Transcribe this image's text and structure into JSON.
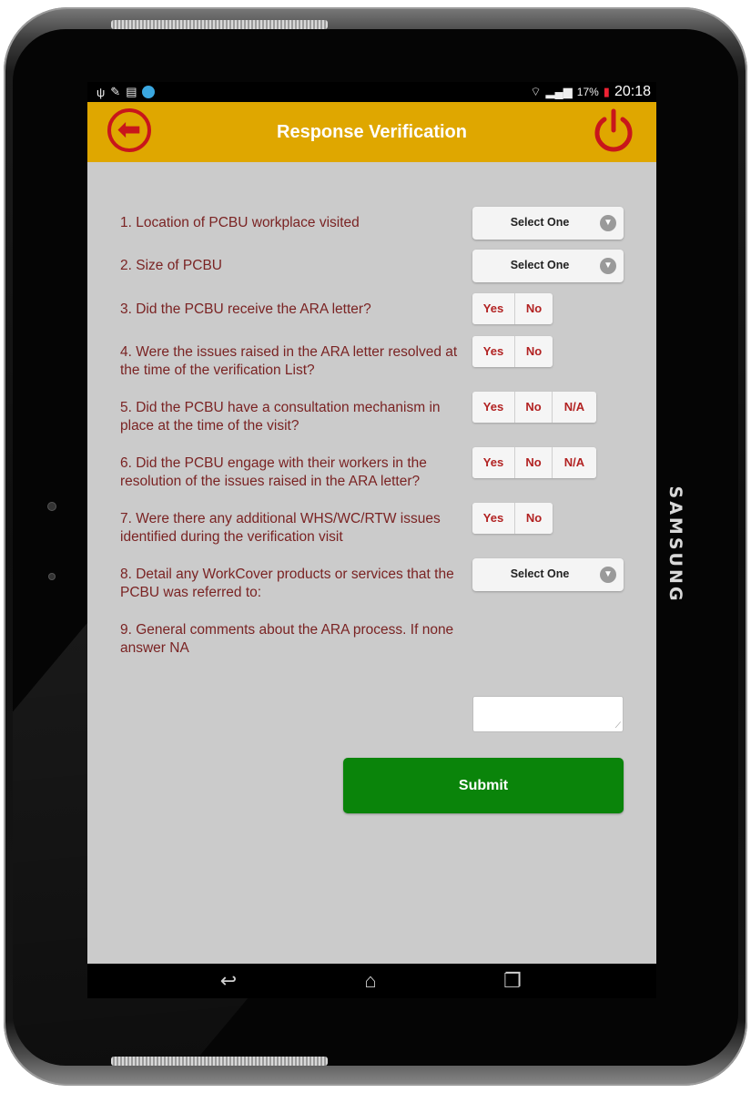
{
  "device": {
    "brand": "SAMSUNG"
  },
  "statusbar": {
    "left_icons": [
      "usb-icon",
      "pencil-icon",
      "clipboard-icon",
      "app-icon"
    ],
    "battery_percent": "17%",
    "time": "20:18"
  },
  "header": {
    "title": "Response Verification",
    "back_icon": "back-arrow-icon",
    "power_icon": "power-icon",
    "accent_color": "#dfa700",
    "icon_color": "#c8161b"
  },
  "form": {
    "questions": [
      {
        "label": "1. Location of PCBU workplace visited",
        "control": "select",
        "value": "Select One"
      },
      {
        "label": "2. Size of PCBU",
        "control": "select",
        "value": "Select One"
      },
      {
        "label": "3. Did the PCBU receive the ARA letter?",
        "control": "toggle",
        "options": [
          "Yes",
          "No"
        ]
      },
      {
        "label": "4. Were the issues raised in the ARA letter resolved at the time of the verification List?",
        "control": "toggle",
        "options": [
          "Yes",
          "No"
        ]
      },
      {
        "label": "5. Did the PCBU have a consultation mechanism in place at the time of the visit?",
        "control": "toggle",
        "options": [
          "Yes",
          "No",
          "N/A"
        ]
      },
      {
        "label": "6. Did the PCBU engage with their workers in the resolution of the issues raised in the ARA letter?",
        "control": "toggle",
        "options": [
          "Yes",
          "No",
          "N/A"
        ]
      },
      {
        "label": "7. Were there any additional WHS/WC/RTW issues identified during the verification visit",
        "control": "toggle",
        "options": [
          "Yes",
          "No"
        ]
      },
      {
        "label": "8. Detail any WorkCover products or services that the PCBU was referred to:",
        "control": "select",
        "value": "Select One"
      },
      {
        "label": "9. General comments about the ARA process. If none answer NA",
        "control": "textarea",
        "value": ""
      }
    ],
    "submit_label": "Submit",
    "submit_color": "#0a840a"
  },
  "navbar": {
    "items": [
      "back-nav-icon",
      "home-icon",
      "recent-apps-icon"
    ]
  }
}
